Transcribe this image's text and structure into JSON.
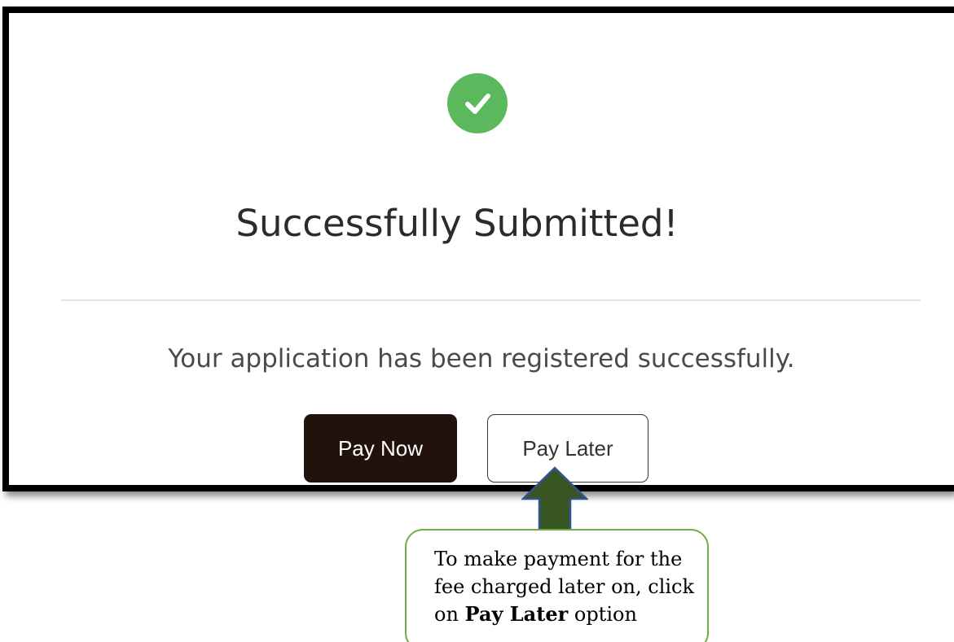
{
  "dialog": {
    "status_icon": "check-circle-icon",
    "status_color": "#5cb85c",
    "title": "Successfully Submitted!",
    "message": "Your application has been registered successfully.",
    "buttons": {
      "pay_now": "Pay Now",
      "pay_later": "Pay Later"
    }
  },
  "annotation": {
    "arrow_icon": "up-arrow-icon",
    "arrow_color": "#375623",
    "text_before": "To make payment for the fee charged later on, click on ",
    "text_bold": "Pay Later",
    "text_after": " option"
  }
}
